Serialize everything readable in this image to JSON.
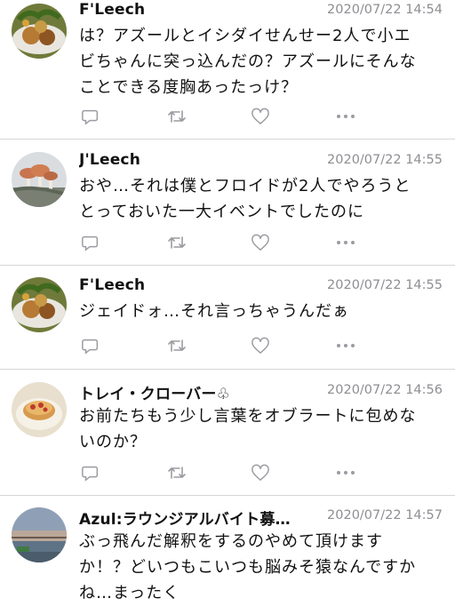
{
  "tweets": [
    {
      "name": "F'Leech",
      "time": "2020/07/22 14:54",
      "text": "は？アズールとイシダイせんせー2人で小エ\nビちゃんに突っ込んだの？アズールにそんな\nことできる度胸あったっけ？",
      "avatar": "food-plate"
    },
    {
      "name": "J'Leech",
      "time": "2020/07/22 14:55",
      "text": "おや…それは僕とフロイドが2人でやろうと\nとっておいた一大イベントでしたのに",
      "avatar": "mushrooms"
    },
    {
      "name": "F'Leech",
      "time": "2020/07/22 14:55",
      "text": "ジェイドォ…それ言っちゃうんだぁ",
      "avatar": "food-plate"
    },
    {
      "name": "トレイ・クローバー♧",
      "time": "2020/07/22 14:56",
      "text": "お前たちもう少し言葉をオブラートに包めな\nいのか？",
      "avatar": "cake"
    },
    {
      "name": "Azul:ラウンジアルバイト募…",
      "time": "2020/07/22 14:57",
      "text": "ぶっ飛んだ解釈をするのやめて頂けます\nか！？どいつもこいつも脳みそ猿なんですか\nね…まったく",
      "avatar": "landscape"
    }
  ],
  "icons": {
    "reply": "reply-icon",
    "retweet": "retweet-icon",
    "like": "like-icon",
    "more": "more-icon"
  },
  "colors": {
    "icon": "#9b9ba1",
    "timestamp": "#8e8e93",
    "divider": "#d6d6d6"
  }
}
